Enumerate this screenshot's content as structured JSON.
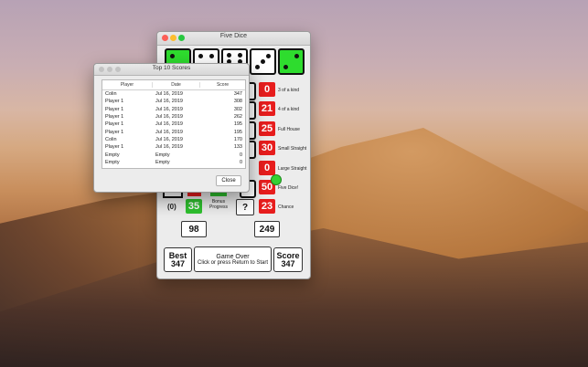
{
  "main_window": {
    "title": "Five Dice",
    "dice": [
      {
        "value": 2,
        "held": true
      },
      {
        "value": 3,
        "held": false
      },
      {
        "value": 6,
        "held": false
      },
      {
        "value": 3,
        "held": false
      },
      {
        "value": 2,
        "held": true
      }
    ],
    "left_col": {
      "upper_bonus_indicator": "(0)",
      "bonus_score": "35",
      "bonus_label_1": "Bonus",
      "bonus_label_2": "Progress",
      "upper_total": "98"
    },
    "right_col": {
      "categories": [
        {
          "name": "3 of a kind",
          "score": "0"
        },
        {
          "name": "4 of a kind",
          "score": "21"
        },
        {
          "name": "Full House",
          "score": "25"
        },
        {
          "name": "Small Straight",
          "score": "30"
        },
        {
          "name": "Large Straight",
          "score": "0"
        },
        {
          "name": "Five Dice!",
          "score": "50"
        },
        {
          "name": "Chance",
          "score": "23"
        }
      ],
      "question_mark": "?",
      "lower_total": "249"
    },
    "bottom": {
      "best_label": "Best",
      "best_value": "347",
      "status_line1": "Game Over",
      "status_line2": "Click or press Return to Start",
      "score_label": "Score",
      "score_value": "347"
    },
    "colors": {
      "held": "#2edc2e",
      "score": "#e71d1d",
      "bonus": "#2fc22f"
    }
  },
  "top10_window": {
    "title": "Top 10 Scores",
    "headers": [
      "Player",
      "Date",
      "Score"
    ],
    "rows": [
      [
        "Colin",
        "Jul 16, 2019",
        "347"
      ],
      [
        "Player 1",
        "Jul 16, 2019",
        "308"
      ],
      [
        "Player 1",
        "Jul 16, 2019",
        "302"
      ],
      [
        "Player 1",
        "Jul 16, 2019",
        "262"
      ],
      [
        "Player 1",
        "Jul 16, 2019",
        "195"
      ],
      [
        "Player 1",
        "Jul 16, 2019",
        "195"
      ],
      [
        "Colin",
        "Jul 16, 2019",
        "170"
      ],
      [
        "Player 1",
        "Jul 16, 2019",
        "133"
      ],
      [
        "Empty",
        "Empty",
        "0"
      ],
      [
        "Empty",
        "Empty",
        "0"
      ]
    ],
    "close_label": "Close"
  }
}
